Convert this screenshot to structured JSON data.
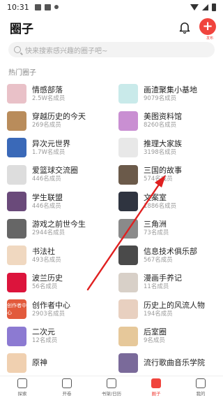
{
  "status_bar": {
    "time": "10:31"
  },
  "header": {
    "title": "圈子",
    "create_label": "发布"
  },
  "search": {
    "placeholder": "快来搜索感兴趣的圈子吧~"
  },
  "section": {
    "title": "热门圈子"
  },
  "circles": [
    {
      "name": "情感部落",
      "members": "2.5W名成员",
      "color": "#e9c1c8"
    },
    {
      "name": "画渣聚集小基地",
      "members": "9079名成员",
      "color": "#c9eaea"
    },
    {
      "name": "穿越历史的今天",
      "members": "269名成员",
      "color": "#b98c5b"
    },
    {
      "name": "美图资料馆",
      "members": "8260名成员",
      "color": "#c98fd2"
    },
    {
      "name": "异次元世界",
      "members": "1.7W名成员",
      "color": "#3a69b8"
    },
    {
      "name": "推理大家族",
      "members": "3198名成员",
      "color": "#e8e8e8"
    },
    {
      "name": "爱篮球交流圈",
      "members": "446名成员",
      "color": "#dddddd"
    },
    {
      "name": "三国的故事",
      "members": "574名成员",
      "color": "#6b5a4a"
    },
    {
      "name": "学生联盟",
      "members": "446名成员",
      "color": "#6a4a7a"
    },
    {
      "name": "文案室",
      "members": "1886名成员",
      "color": "#2f3440"
    },
    {
      "name": "游戏之前世今生",
      "members": "2944名成员",
      "color": "#666666"
    },
    {
      "name": "三角洲",
      "members": "73名成员",
      "color": "#8a8a8a"
    },
    {
      "name": "书法社",
      "members": "493名成员",
      "color": "#f0d8c0"
    },
    {
      "name": "信息技术俱乐部",
      "members": "567名成员",
      "color": "#4a4a4a"
    },
    {
      "name": "波兰历史",
      "members": "56名成员",
      "color": "#dc143c"
    },
    {
      "name": "漫画手养记",
      "members": "11名成员",
      "color": "#d8d0c8"
    },
    {
      "name": "创作者中心",
      "members": "2903名成员",
      "color": "#e25a3c",
      "thumb_text": "创作者中心"
    },
    {
      "name": "历史上的风流人物",
      "members": "194名成员",
      "color": "#e8d0c0"
    },
    {
      "name": "二次元",
      "members": "12名成员",
      "color": "#8c7ad2"
    },
    {
      "name": "后室圈",
      "members": "9名成员",
      "color": "#e6c89a"
    },
    {
      "name": "原神",
      "members": "",
      "color": "#f0d0b0"
    },
    {
      "name": "流行歌曲音乐学院",
      "members": "",
      "color": "#7a6a9a"
    }
  ],
  "tabs": [
    {
      "label": "探索",
      "active": false
    },
    {
      "label": "开卷",
      "active": false
    },
    {
      "label": "书架/日历",
      "active": false
    },
    {
      "label": "圈子",
      "active": true
    },
    {
      "label": "我的",
      "active": false
    }
  ],
  "colors": {
    "accent": "#f0443d",
    "annotation_arrow": "#e02020"
  }
}
